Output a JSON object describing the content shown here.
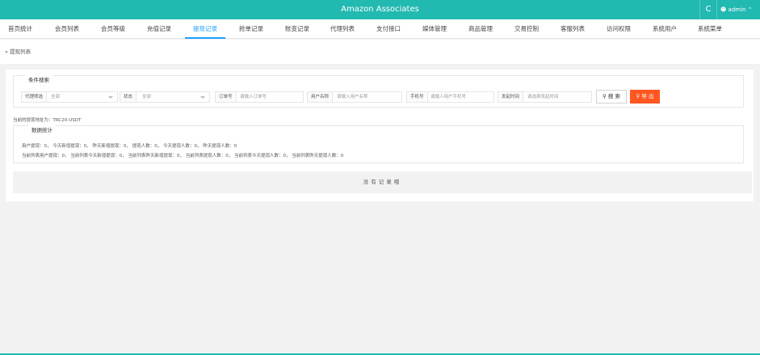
{
  "app": {
    "title": "Amazon Associates",
    "refresh_icon": "C",
    "user_label": "admin",
    "user_icon": "user-icon",
    "chevron": "^"
  },
  "nav": {
    "items": [
      {
        "label": "首页统计",
        "active": false
      },
      {
        "label": "会员列表",
        "active": false
      },
      {
        "label": "会员等级",
        "active": false
      },
      {
        "label": "充值记录",
        "active": false
      },
      {
        "label": "提现记录",
        "active": true
      },
      {
        "label": "抢单记录",
        "active": false
      },
      {
        "label": "账变记录",
        "active": false
      },
      {
        "label": "代理列表",
        "active": false
      },
      {
        "label": "支付接口",
        "active": false
      },
      {
        "label": "媒体管理",
        "active": false
      },
      {
        "label": "商品管理",
        "active": false
      },
      {
        "label": "交易控制",
        "active": false
      },
      {
        "label": "客服列表",
        "active": false
      },
      {
        "label": "访问权限",
        "active": false
      },
      {
        "label": "系统用户",
        "active": false
      },
      {
        "label": "系统菜单",
        "active": false
      }
    ]
  },
  "breadcrumb": {
    "icon": "»",
    "text": "提现列表"
  },
  "search": {
    "legend": "条件搜索",
    "agent": {
      "label": "代理筛选",
      "value": "全部"
    },
    "status": {
      "label": "状态",
      "value": "全部"
    },
    "order": {
      "label": "订单号",
      "placeholder": "请输入订单号"
    },
    "account": {
      "label": "用户名称",
      "placeholder": "请输入用户名称"
    },
    "phone": {
      "label": "手机号",
      "placeholder": "请输入用户手机号"
    },
    "time": {
      "label": "发起时间",
      "placeholder": "请选择发起时间"
    },
    "search_button": "搜 索",
    "export_button": "导 出",
    "search_icon": "search-icon"
  },
  "receive_note": "当前的提现地址为：TRC20-USDT",
  "stats": {
    "legend": "数据统计",
    "line1": "用户提现：0，  今天新增提现：0，  昨天新增提现：0，  提现人数：0，  今天提现人数：0，  昨天提现人数：0",
    "line2": "当前列表用户提现：0，  当前列表今天新增提现：0，  当前列表昨天新增提现：0，  当前列表提现人数：0，  当前列表今天提现人数：0，  当前列表昨天提现人数：0"
  },
  "empty": "没有记录哦",
  "colors": {
    "header": "#22b9b1",
    "active_nav": "#1e9fff",
    "export_button": "#ff5722"
  }
}
